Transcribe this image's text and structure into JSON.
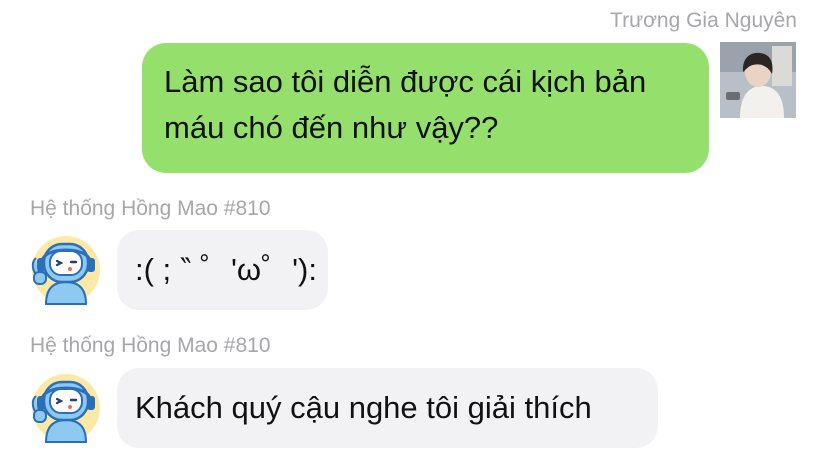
{
  "messages": [
    {
      "sender": "Trương Gia Nguyên",
      "side": "right",
      "text": "Làm sao tôi diễn được cái kịch bản máu chó đến như vậy??",
      "lines": [
        "Làm sao tôi diễn được cái kịch bản",
        "máu chó đến như vậy??"
      ]
    },
    {
      "sender": "Hệ thống Hồng Mao #810",
      "side": "left",
      "text": ":( ; ‶ ゜'ω゜'):"
    },
    {
      "sender": "Hệ thống Hồng Mao #810",
      "side": "left",
      "text": "Khách quý cậu nghe tôi giải thích"
    }
  ],
  "colors": {
    "outgoing_bubble": "#95e06c",
    "incoming_bubble": "#f2f2f4",
    "sender_name": "#a7a7ab"
  },
  "icons": {
    "user_avatar": "user-photo-avatar",
    "bot_avatar": "robot-mascot-avatar"
  }
}
